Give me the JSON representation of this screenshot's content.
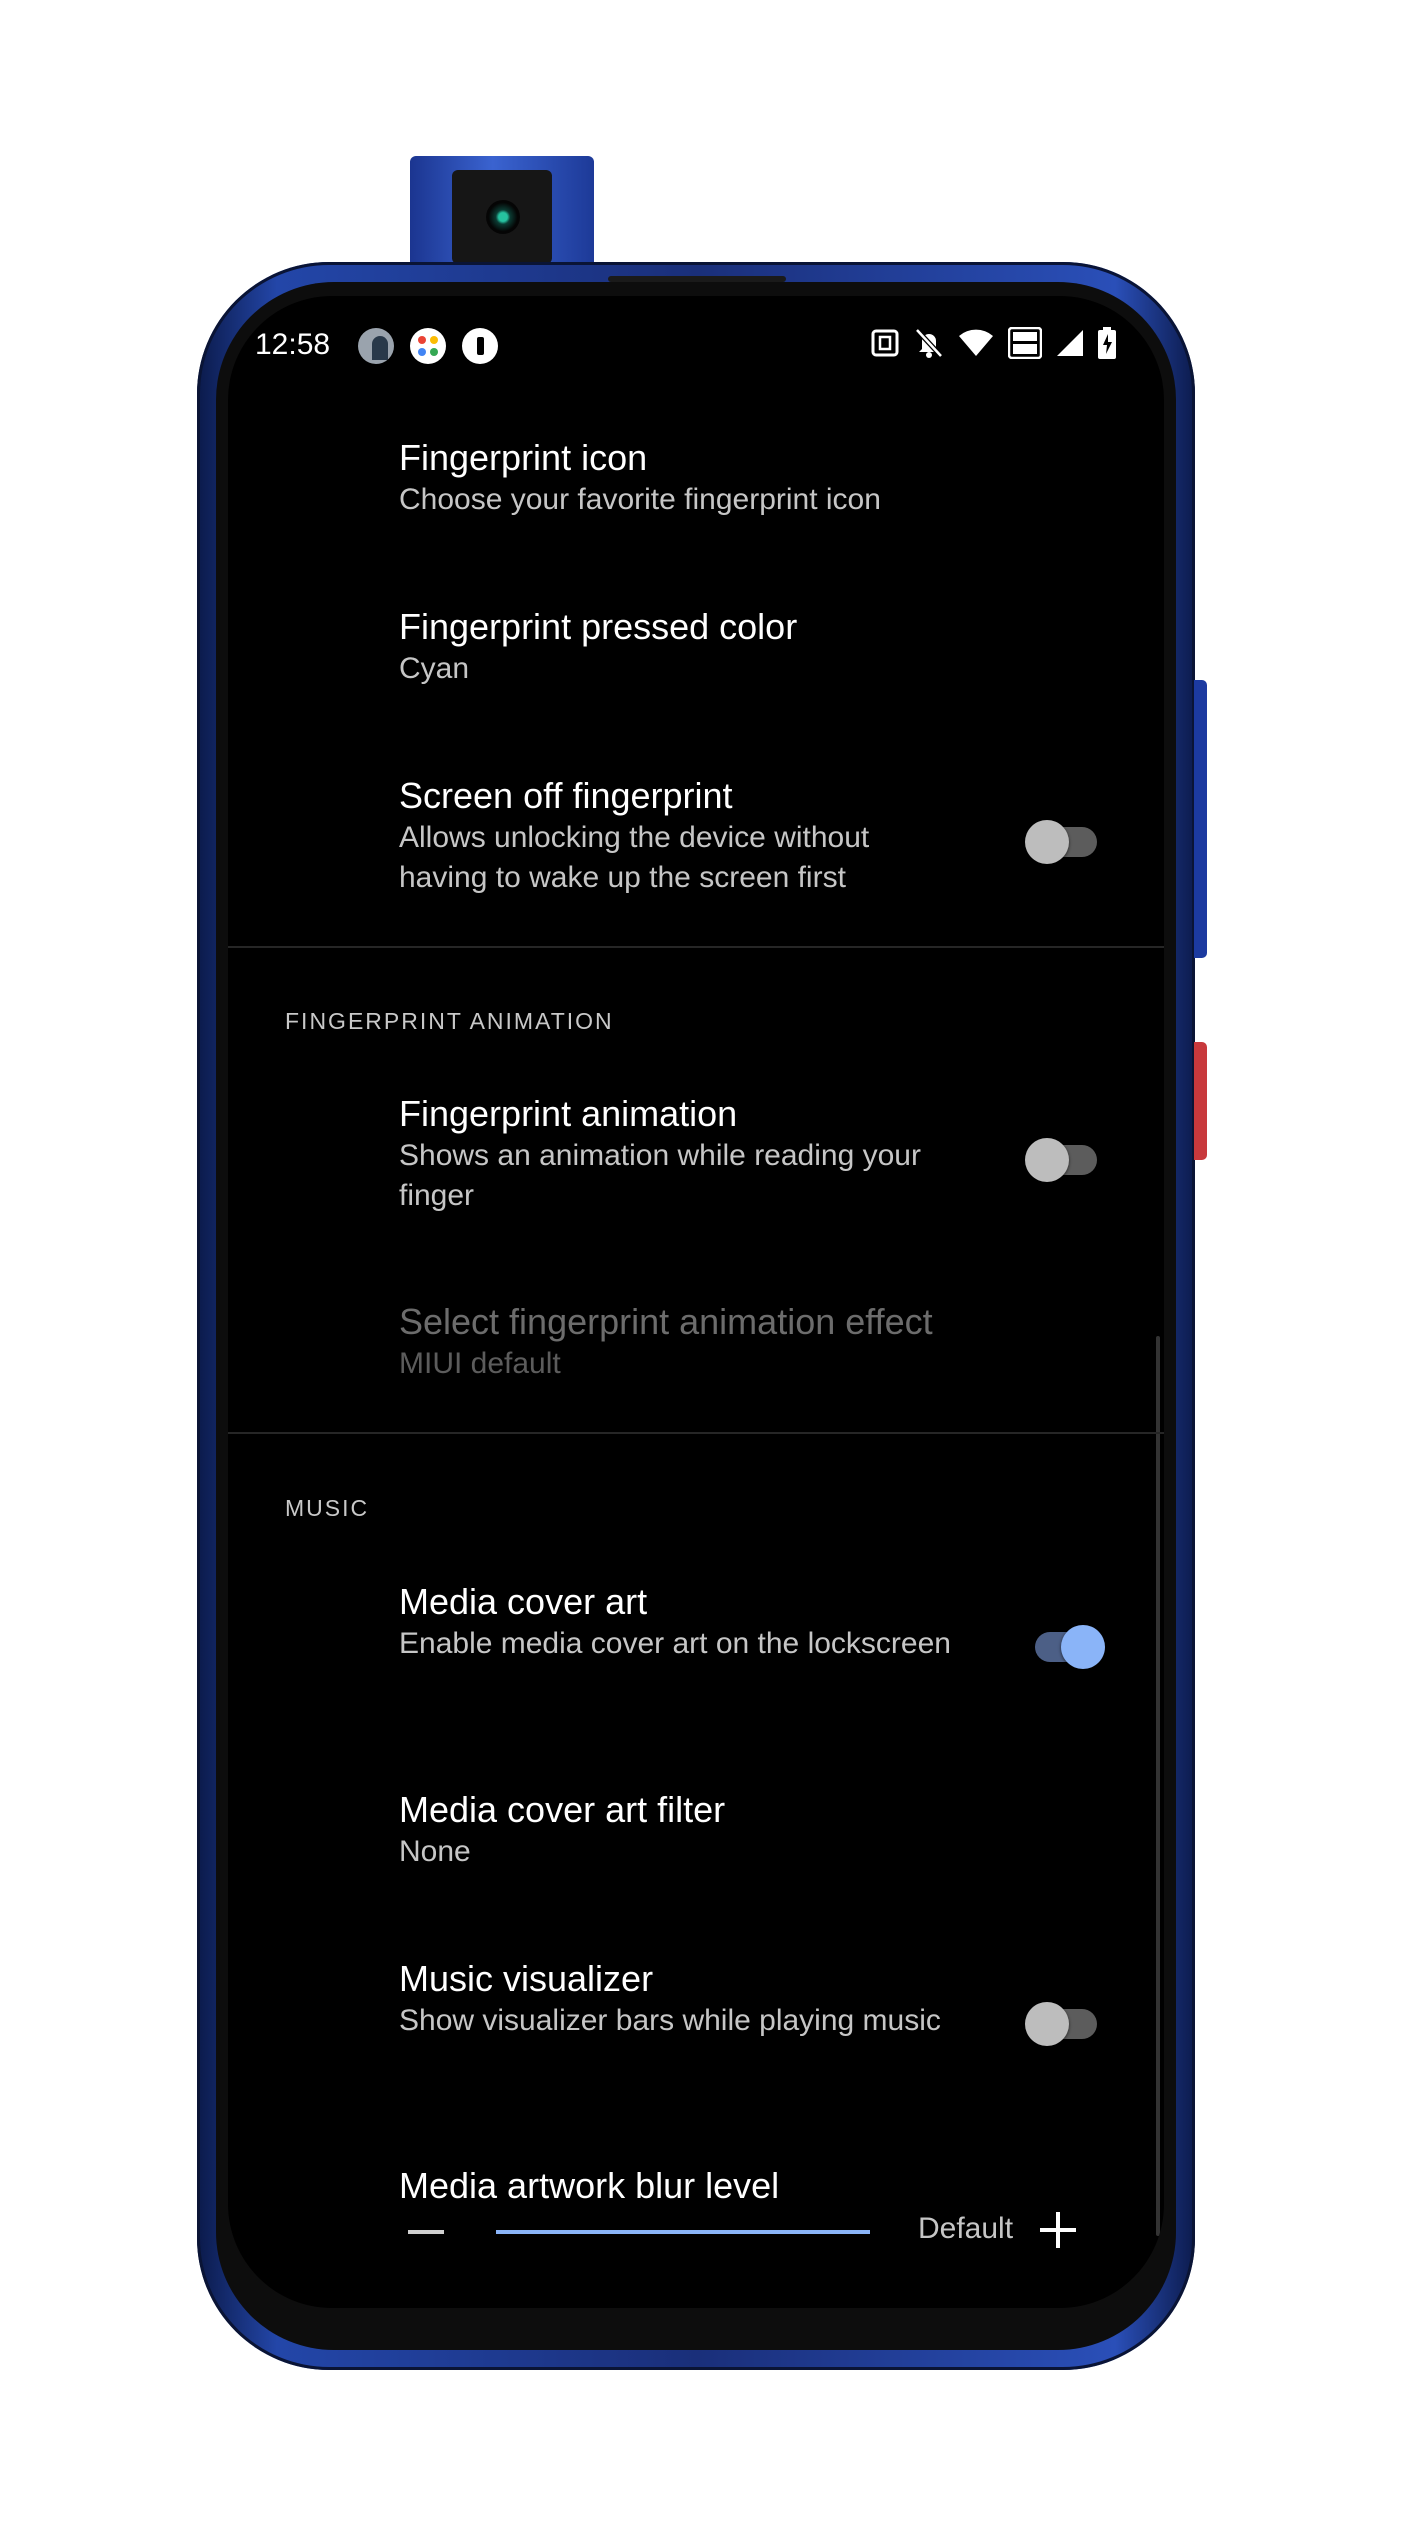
{
  "status_bar": {
    "time": "12:58",
    "notification_icons": [
      "avatar-icon",
      "google-photos-icon",
      "battery-notification-icon"
    ],
    "system_icons": [
      "nfc-icon",
      "notifications-off-icon",
      "wifi-icon",
      "volte-icon",
      "cell-signal-icon",
      "battery-charging-icon"
    ]
  },
  "items": [
    {
      "title": "Fingerprint icon",
      "summary": "Choose your favorite fingerprint icon"
    },
    {
      "title": "Fingerprint pressed color",
      "summary": "Cyan"
    },
    {
      "title": "Screen off fingerprint",
      "summary": "Allows unlocking the device without having to wake up the screen first",
      "switch_on": false
    }
  ],
  "sections": [
    {
      "header": "FINGERPRINT ANIMATION",
      "items": [
        {
          "title": "Fingerprint animation",
          "summary": "Shows an animation while reading your finger",
          "switch_on": false
        },
        {
          "title": "Select fingerprint animation effect",
          "summary": "MIUI default",
          "enabled": false
        }
      ]
    },
    {
      "header": "MUSIC",
      "items": [
        {
          "title": "Media cover art",
          "summary": "Enable media cover art on the lockscreen",
          "switch_on": true
        },
        {
          "title": "Media cover art filter",
          "summary": "None"
        },
        {
          "title": "Music visualizer",
          "summary": "Show visualizer bars while playing music",
          "switch_on": false
        },
        {
          "title": "Media artwork blur level",
          "value_label": "Default"
        }
      ]
    }
  ],
  "colors": {
    "accent": "#8ab4f8",
    "background": "#000000",
    "frame": "#2346a8"
  }
}
